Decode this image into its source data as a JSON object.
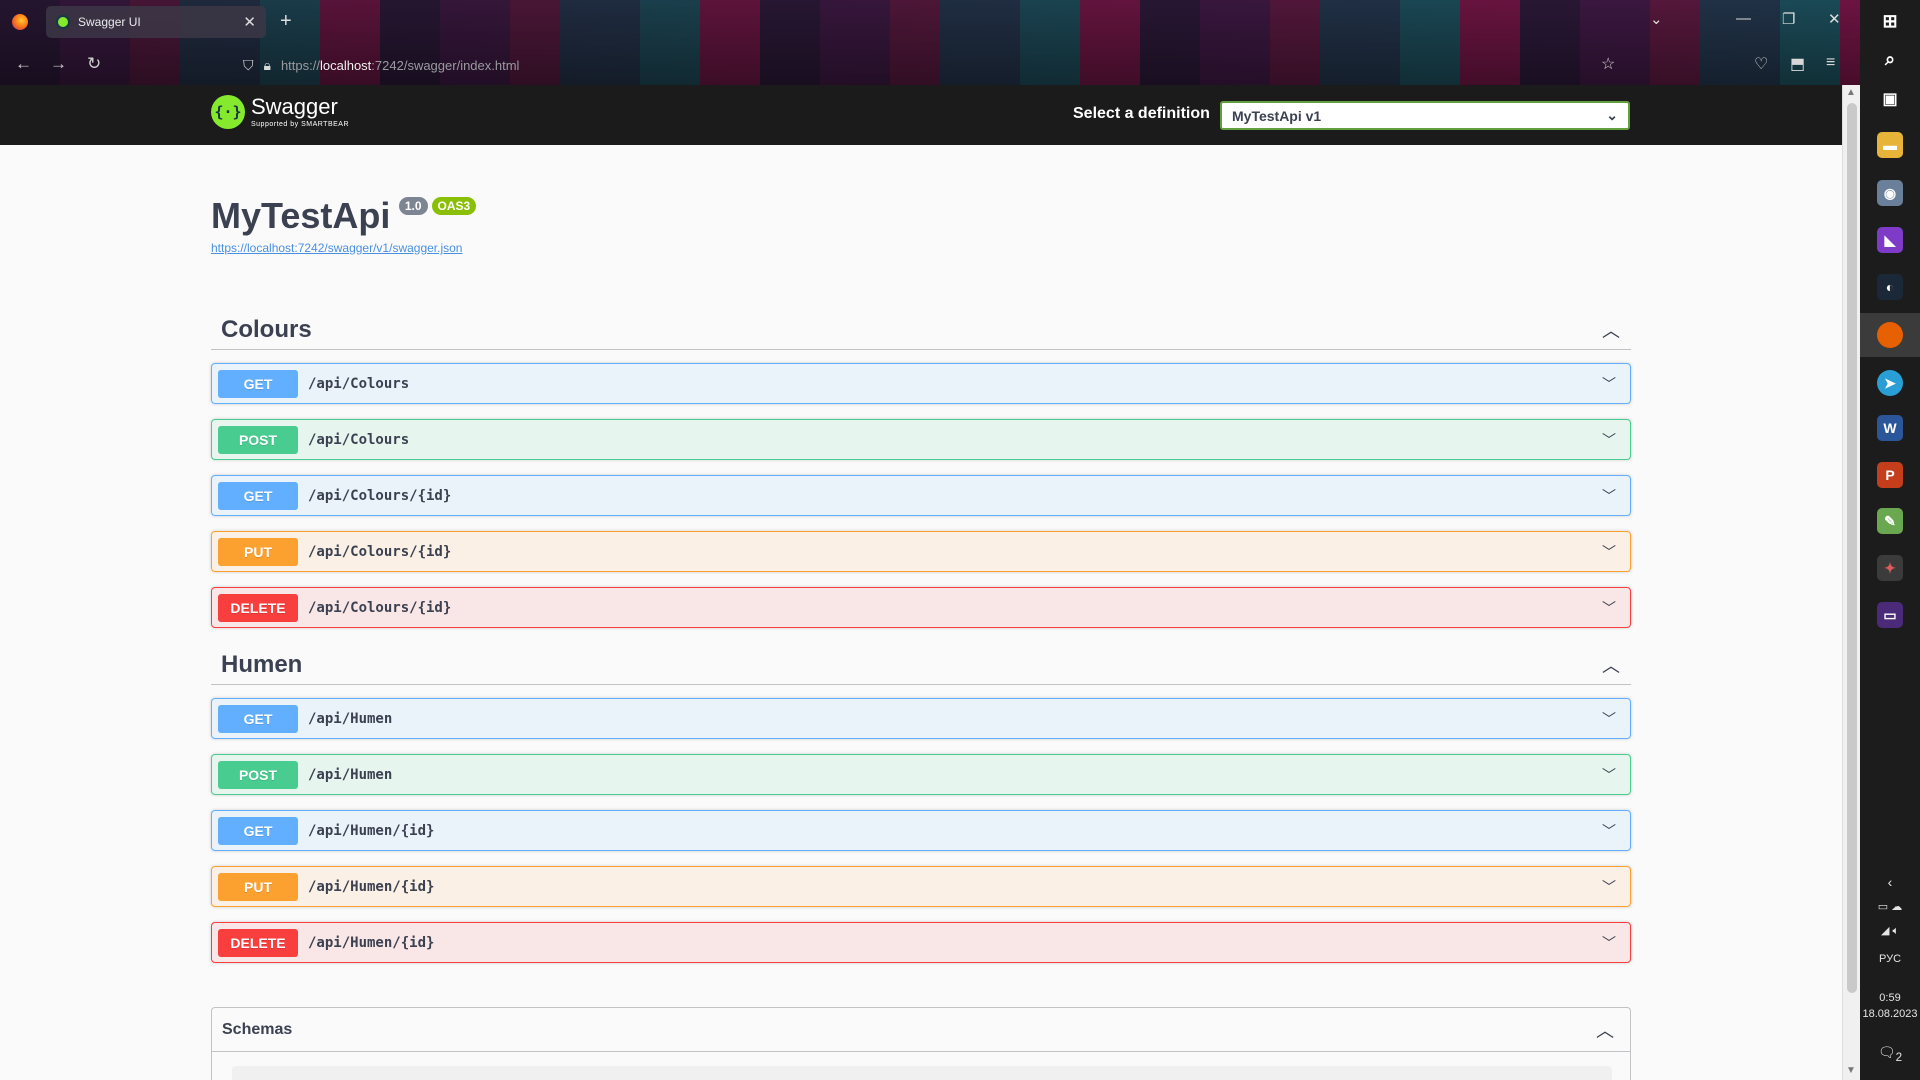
{
  "browser": {
    "tab_title": "Swagger UI",
    "url_prefix": "https://",
    "url_host": "localhost",
    "url_rest": ":7242/swagger/index.html"
  },
  "swagger": {
    "brand": "Swagger",
    "brand_sub": "Supported by SMARTBEAR",
    "select_label": "Select a definition",
    "selected_definition": "MyTestApi v1"
  },
  "info": {
    "title": "MyTestApi",
    "version": "1.0",
    "oas": "OAS3",
    "spec_url": "https://localhost:7242/swagger/v1/swagger.json"
  },
  "tags": [
    {
      "name": "Colours",
      "operations": [
        {
          "method": "GET",
          "path": "/api/Colours"
        },
        {
          "method": "POST",
          "path": "/api/Colours"
        },
        {
          "method": "GET",
          "path": "/api/Colours/{id}"
        },
        {
          "method": "PUT",
          "path": "/api/Colours/{id}"
        },
        {
          "method": "DELETE",
          "path": "/api/Colours/{id}"
        }
      ]
    },
    {
      "name": "Humen",
      "operations": [
        {
          "method": "GET",
          "path": "/api/Humen"
        },
        {
          "method": "POST",
          "path": "/api/Humen"
        },
        {
          "method": "GET",
          "path": "/api/Humen/{id}"
        },
        {
          "method": "PUT",
          "path": "/api/Humen/{id}"
        },
        {
          "method": "DELETE",
          "path": "/api/Humen/{id}"
        }
      ]
    }
  ],
  "schemas": {
    "title": "Schemas"
  },
  "taskbar": {
    "language": "РУС",
    "time": "0:59",
    "date": "18.08.2023",
    "notification_count": "2"
  }
}
